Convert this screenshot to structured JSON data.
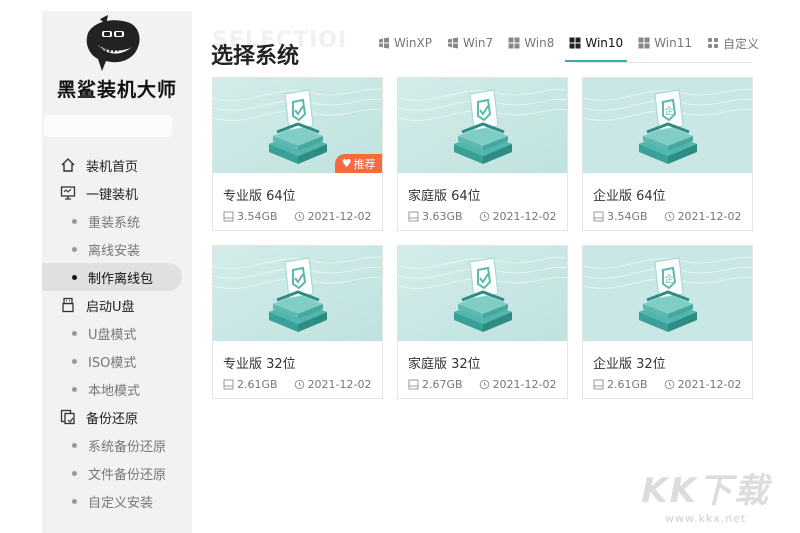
{
  "app": {
    "title": "黑鲨装机大师",
    "logo_icon": "shark-logo-icon"
  },
  "sidebar": {
    "items": [
      {
        "type": "main",
        "label": "装机首页",
        "icon": "home-icon"
      },
      {
        "type": "main",
        "label": "一键装机",
        "icon": "monitor-icon"
      },
      {
        "type": "sub",
        "label": "重装系统"
      },
      {
        "type": "sub",
        "label": "离线安装"
      },
      {
        "type": "sub",
        "label": "制作离线包",
        "active": true
      },
      {
        "type": "main",
        "label": "启动U盘",
        "icon": "usb-icon"
      },
      {
        "type": "sub",
        "label": "U盘模式"
      },
      {
        "type": "sub",
        "label": "ISO模式"
      },
      {
        "type": "sub",
        "label": "本地模式"
      },
      {
        "type": "main",
        "label": "备份还原",
        "icon": "backup-icon"
      },
      {
        "type": "sub",
        "label": "系统备份还原"
      },
      {
        "type": "sub",
        "label": "文件备份还原"
      },
      {
        "type": "sub",
        "label": "自定义安装"
      }
    ]
  },
  "header": {
    "watermark": "SELECTIOI",
    "title": "选择系统",
    "tabs": [
      {
        "label": "WinXP",
        "icon": "windows-xp-icon"
      },
      {
        "label": "Win7",
        "icon": "windows-7-icon"
      },
      {
        "label": "Win8",
        "icon": "windows-8-icon"
      },
      {
        "label": "Win10",
        "icon": "windows-10-icon",
        "active": true
      },
      {
        "label": "Win11",
        "icon": "windows-11-icon"
      },
      {
        "label": "自定义",
        "icon": "custom-grid-icon"
      }
    ]
  },
  "cards": [
    {
      "name": "专业版 64位",
      "size": "3.54GB",
      "date": "2021-12-02",
      "badge": "推荐",
      "illustration": "check-shield-box-icon"
    },
    {
      "name": "家庭版 64位",
      "size": "3.63GB",
      "date": "2021-12-02",
      "illustration": "check-shield-box-icon"
    },
    {
      "name": "企业版 64位",
      "size": "3.54GB",
      "date": "2021-12-02",
      "illustration": "enterprise-shield-box-icon"
    },
    {
      "name": "专业版 32位",
      "size": "2.61GB",
      "date": "2021-12-02",
      "illustration": "check-shield-box-icon"
    },
    {
      "name": "家庭版 32位",
      "size": "2.67GB",
      "date": "2021-12-02",
      "illustration": "check-shield-box-icon"
    },
    {
      "name": "企业版 32位",
      "size": "2.61GB",
      "date": "2021-12-02",
      "illustration": "enterprise-shield-box-icon"
    }
  ],
  "watermark": {
    "big": "KK下载",
    "small": "www.kkx.net"
  },
  "colors": {
    "accent": "#2db3ad",
    "badge": "#f56b3f",
    "thumb_bg": "#c8e6e3",
    "sidebar_bg": "#f2f2f2"
  }
}
